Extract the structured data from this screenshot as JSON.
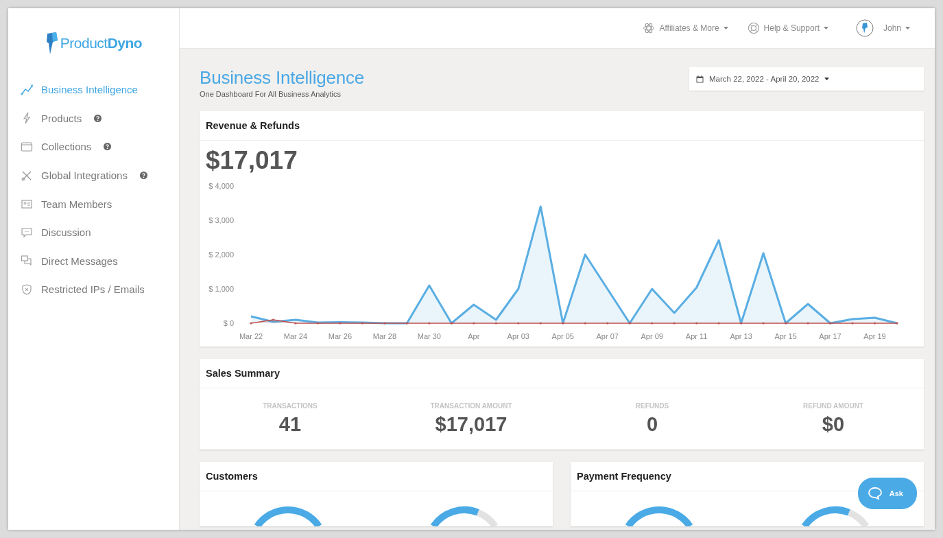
{
  "brand": {
    "name_light": "Product",
    "name_bold": "Dyno"
  },
  "sidebar": {
    "items": [
      {
        "kind": "chart",
        "label": "Business Intelligence",
        "selected": true,
        "help": false
      },
      {
        "kind": "bolt",
        "label": "Products",
        "selected": false,
        "help": true
      },
      {
        "kind": "folder",
        "label": "Collections",
        "selected": false,
        "help": true
      },
      {
        "kind": "tools",
        "label": "Global Integrations",
        "selected": false,
        "help": true
      },
      {
        "kind": "team",
        "label": "Team Members",
        "selected": false,
        "help": false
      },
      {
        "kind": "chat",
        "label": "Discussion",
        "selected": false,
        "help": false
      },
      {
        "kind": "messages",
        "label": "Direct Messages",
        "selected": false,
        "help": false
      },
      {
        "kind": "shield",
        "label": "Restricted IPs / Emails",
        "selected": false,
        "help": false
      }
    ]
  },
  "topbar": {
    "menus": [
      {
        "kind": "atom",
        "label": "Affiliates & More"
      },
      {
        "kind": "lifebuoy",
        "label": "Help & Support"
      },
      {
        "kind": "avatar",
        "label": "John"
      }
    ]
  },
  "page": {
    "title": "Business Intelligence",
    "subtitle": "One Dashboard For All Business Analytics",
    "date_range": "March 22, 2022 - April 20, 2022"
  },
  "revenue": {
    "title": "Revenue & Refunds",
    "total": "$17,017",
    "chart_data": {
      "type": "area",
      "categories": [
        "Mar 22",
        null,
        "Mar 24",
        null,
        "Mar 26",
        null,
        "Mar 28",
        null,
        "Mar 30",
        null,
        "Apr",
        null,
        "Apr 03",
        null,
        "Apr 05",
        null,
        "Apr 07",
        null,
        "Apr 09",
        null,
        "Apr 11",
        null,
        "Apr 13",
        null,
        "Apr 15",
        null,
        "Apr 17",
        null,
        "Apr 19",
        null
      ],
      "yticks": [
        {
          "value": 0,
          "label": "$ 0"
        },
        {
          "value": 1000,
          "label": "$ 1,000"
        },
        {
          "value": 2000,
          "label": "$ 2,000"
        },
        {
          "value": 3000,
          "label": "$ 3,000"
        },
        {
          "value": 4000,
          "label": "$ 4,000"
        }
      ],
      "ylim": [
        0,
        4000
      ],
      "series": [
        {
          "color": "#5aaee3",
          "values": [
            200,
            40,
            100,
            20,
            30,
            20,
            0,
            0,
            1100,
            0,
            540,
            100,
            1000,
            3400,
            0,
            2000,
            1000,
            0,
            1000,
            300,
            1040,
            2420,
            0,
            2040,
            0,
            560,
            0,
            120,
            160,
            0
          ]
        },
        {
          "color": "#c0504d",
          "values": [
            0,
            100,
            0,
            0,
            0,
            0,
            0,
            0,
            0,
            0,
            0,
            0,
            0,
            0,
            0,
            0,
            0,
            0,
            0,
            0,
            0,
            0,
            0,
            0,
            0,
            0,
            0,
            0,
            0,
            0
          ]
        }
      ]
    }
  },
  "sales_summary": {
    "title": "Sales Summary",
    "stats": [
      {
        "label": "TRANSACTIONS",
        "value": "41"
      },
      {
        "label": "TRANSACTION AMOUNT",
        "value": "$17,017"
      },
      {
        "label": "REFUNDS",
        "value": "0"
      },
      {
        "label": "REFUND AMOUNT",
        "value": "$0"
      }
    ]
  },
  "panels": [
    {
      "title": "Customers"
    },
    {
      "title": "Payment Frequency"
    }
  ],
  "chat_button": {
    "label": "Ask"
  }
}
